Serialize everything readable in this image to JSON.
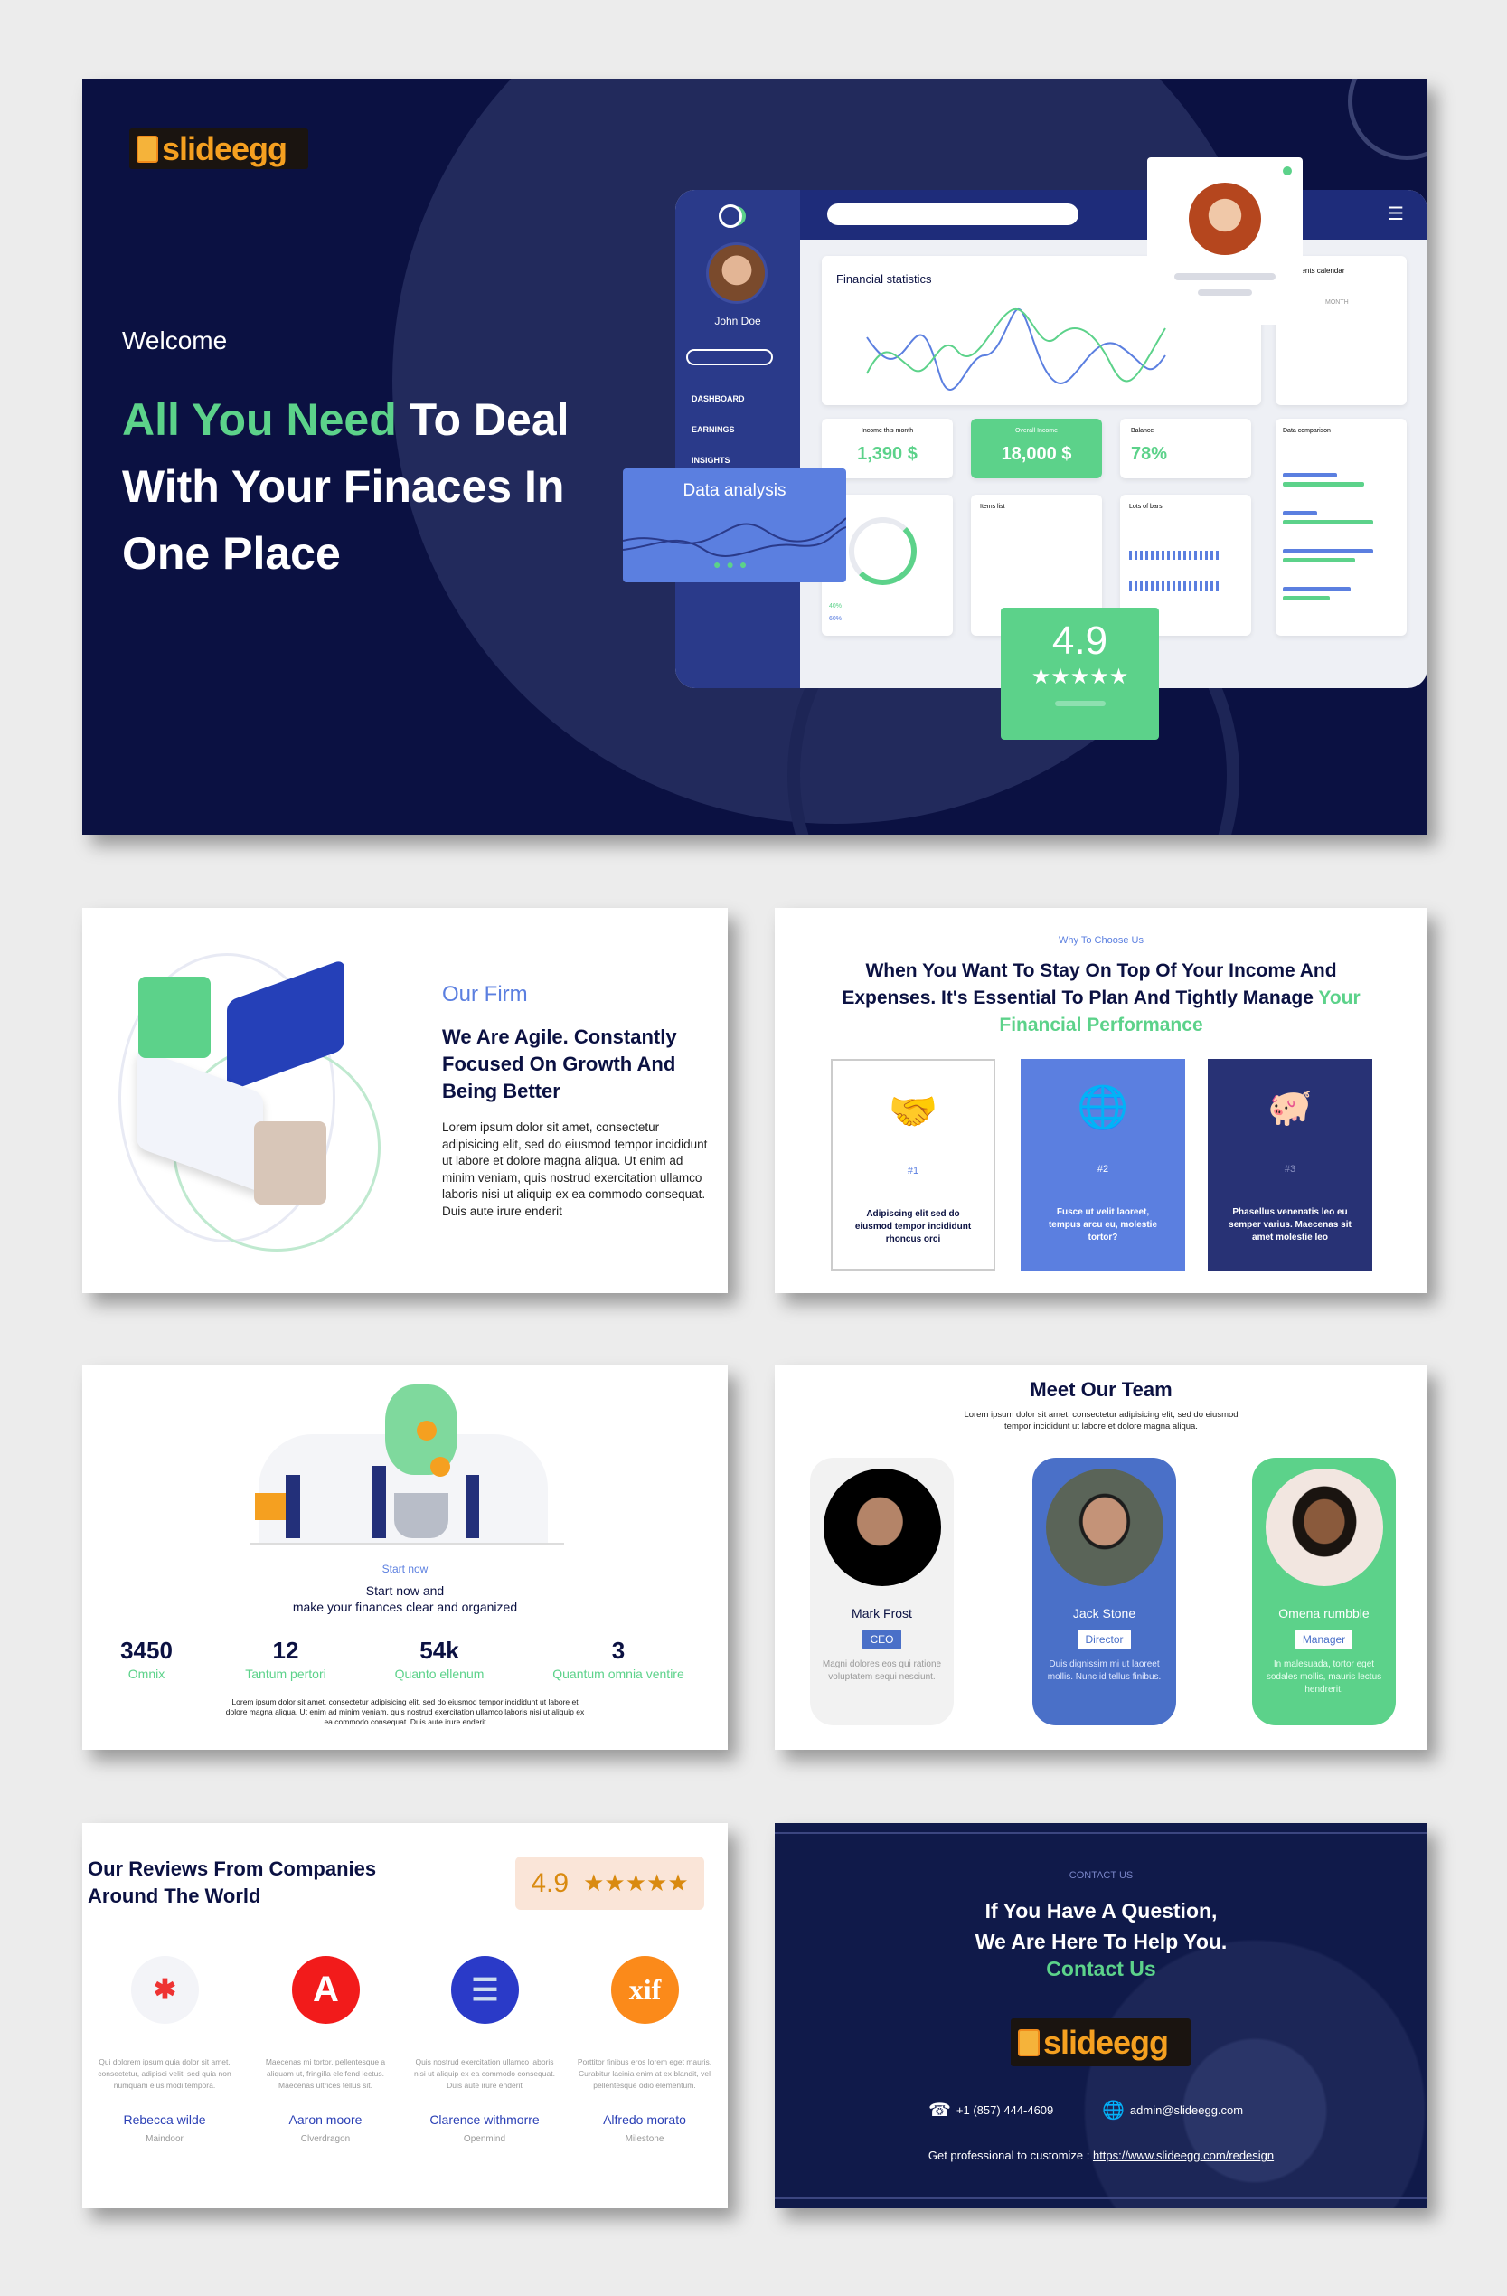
{
  "brand": {
    "logo_text": "slideegg",
    "colors": {
      "navy": "#0b1142",
      "green": "#5cd28a",
      "blue": "#5b7fe0",
      "orange": "#f5a020"
    }
  },
  "hero": {
    "welcome": "Welcome",
    "headline_highlight": "All You Need",
    "headline_rest_1": "To Deal",
    "headline_line2": "With Your Finaces In",
    "headline_line3": "One Place",
    "dashboard": {
      "user_name": "John Doe",
      "nav": [
        "DASHBOARD",
        "EARNINGS",
        "INSIGHTS"
      ],
      "financial_statistics": "Financial statistics",
      "payments_calendar": "Payments calendar",
      "month": "MONTH",
      "income_label": "Income this month",
      "income_value": "1,390 $",
      "overall_label": "Overall Income",
      "overall_value": "18,000 $",
      "balance_label": "Balance",
      "balance_value": "78%",
      "data_comparison": "Data comparison",
      "items_list": "Items list",
      "lots_of_bars": "Lots of bars",
      "legend": [
        "40%",
        "60%"
      ]
    },
    "data_analysis": "Data analysis",
    "rating": "4.9",
    "stars": "★★★★★"
  },
  "firm": {
    "eyebrow": "Our Firm",
    "heading": "We Are Agile. Constantly Focused On Growth And Being Better",
    "body": "Lorem ipsum dolor sit amet, consectetur adipisicing elit, sed do eiusmod tempor incididunt ut labore et dolore magna aliqua. Ut enim ad minim veniam, quis nostrud exercitation ullamco laboris nisi ut aliquip ex ea commodo consequat. Duis aute irure enderit"
  },
  "why": {
    "eyebrow": "Why To Choose Us",
    "heading": "When You Want To Stay On Top Of Your Income And Expenses. It's Essential To Plan And Tightly Manage",
    "heading_highlight": "Your Financial Performance",
    "cards": [
      {
        "icon": "handshake-icon",
        "num": "#1",
        "text": "Adipiscing elit sed do eiusmod tempor incididunt rhoncus orci"
      },
      {
        "icon": "globe-map-icon",
        "num": "#2",
        "text": "Fusce ut velit laoreet, tempus arcu eu, molestie tortor?"
      },
      {
        "icon": "piggy-bank-icon",
        "num": "#3",
        "text": "Phasellus venenatis leo eu semper varius. Maecenas sit amet molestie leo"
      }
    ]
  },
  "start": {
    "eyebrow": "Start now",
    "title_1": "Start now and",
    "title_2": "make your finances clear and organized",
    "stats": [
      {
        "value": "3450",
        "label": "Omnix"
      },
      {
        "value": "12",
        "label": "Tantum pertori"
      },
      {
        "value": "54k",
        "label": "Quanto ellenum"
      },
      {
        "value": "3",
        "label": "Quantum omnia ventire"
      }
    ],
    "body": "Lorem ipsum dolor sit amet, consectetur adipisicing elit, sed do eiusmod tempor incididunt ut labore et dolore magna aliqua. Ut enim ad minim veniam, quis nostrud exercitation ullamco laboris nisi ut aliquip ex ea commodo  consequat. Duis aute irure enderit"
  },
  "team": {
    "title": "Meet Our Team",
    "subtitle": "Lorem ipsum dolor sit amet, consectetur adipisicing elit, sed do eiusmod tempor incididunt ut labore et dolore magna aliqua.",
    "members": [
      {
        "name": "Mark Frost",
        "role": "CEO",
        "desc": "Magni dolores eos qui ratione voluptatem sequi nesciunt."
      },
      {
        "name": "Jack Stone",
        "role": "Director",
        "desc": "Duis dignissim mi ut laoreet mollis. Nunc id tellus finibus."
      },
      {
        "name": "Omena rumbble",
        "role": "Manager",
        "desc": "In malesuada, tortor eget sodales mollis, mauris lectus hendrerit."
      }
    ]
  },
  "reviews": {
    "title_1": "Our Reviews From Companies",
    "title_2": "Around The World",
    "rating": "4.9",
    "stars": "★★★★★",
    "items": [
      {
        "logo": "pinwheel-logo",
        "desc": "Qui dolorem ipsum quia dolor sit amet, consectetur, adipisci velit, sed quia non numquam eius modi tempora.",
        "name": "Rebecca wilde",
        "company": "Maindoor"
      },
      {
        "logo": "A",
        "desc": "Maecenas mi tortor, pellentesque a aliquam ut, fringilla eleifend lectus. Maecenas ultrices tellus sit.",
        "name": "Aaron moore",
        "company": "Clverdragon"
      },
      {
        "logo": "stack-logo",
        "desc": "Quis nostrud exercitation ullamco laboris nisi ut aliquip ex ea commodo consequat. Duis aute irure enderit",
        "name": "Clarence withmorre",
        "company": "Openmind"
      },
      {
        "logo": "xif",
        "desc": "Porttitor finibus eros lorem eget mauris. Curabitur lacinia enim at ex blandit, vel pellentesque odio elementum.",
        "name": "Alfredo morato",
        "company": "Milestone"
      }
    ]
  },
  "contact": {
    "eyebrow": "CONTACT US",
    "line1": "If You Have A Question,",
    "line2": "We Are Here To Help You.",
    "cta": "Contact Us",
    "phone": "+1 (857) 444-4609",
    "email": "admin@slideegg.com",
    "customize_label": "Get professional to customize :",
    "customize_link": "https://www.slideegg.com/redesign"
  }
}
